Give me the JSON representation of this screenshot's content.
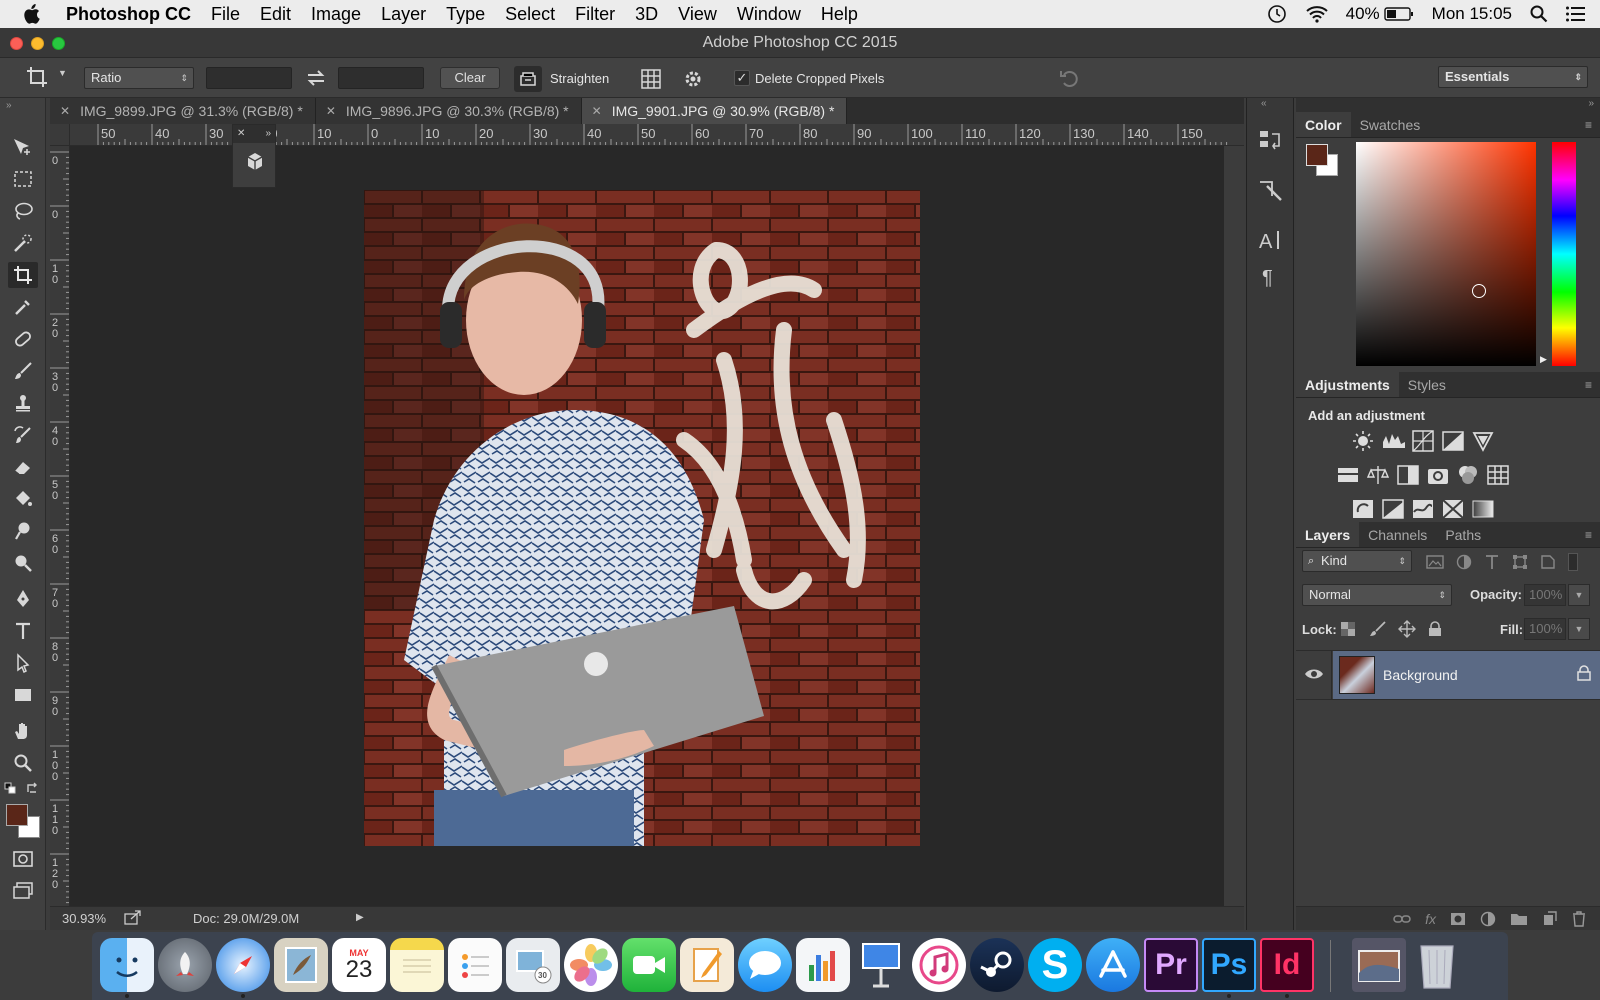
{
  "menubar": {
    "app": "Photoshop CC",
    "items": [
      "File",
      "Edit",
      "Image",
      "Layer",
      "Type",
      "Select",
      "Filter",
      "3D",
      "View",
      "Window",
      "Help"
    ],
    "battery": "40%",
    "clock": "Mon 15:05"
  },
  "window": {
    "title": "Adobe Photoshop CC 2015"
  },
  "options": {
    "ratio": "Ratio",
    "clear": "Clear",
    "straighten": "Straighten",
    "delete_cropped": "Delete Cropped Pixels",
    "delete_cropped_checked": true,
    "workspace": "Essentials"
  },
  "tabs": [
    {
      "label": "IMG_9899.JPG @ 31.3% (RGB/8) *",
      "active": false
    },
    {
      "label": "IMG_9896.JPG @ 30.3% (RGB/8) *",
      "active": false
    },
    {
      "label": "IMG_9901.JPG @ 30.9% (RGB/8) *",
      "active": true
    }
  ],
  "ruler": {
    "h_ticks": [
      "50",
      "40",
      "30",
      "20",
      "10",
      "0",
      "10",
      "20",
      "30",
      "40",
      "50",
      "60",
      "70",
      "80",
      "90",
      "100",
      "110",
      "120",
      "130",
      "140",
      "150"
    ],
    "v_ticks": [
      "0",
      "0",
      "1\n0",
      "2\n0",
      "3\n0",
      "4\n0",
      "5\n0",
      "6\n0",
      "7\n0",
      "8\n0",
      "9\n0",
      "1\n0\n0",
      "1\n1\n0",
      "1\n2\n0"
    ]
  },
  "status": {
    "zoom": "30.93%",
    "doc": "Doc: 29.0M/29.0M"
  },
  "colors": {
    "foreground": "#5a2618",
    "background": "#ffffff",
    "picker_hue": "#ff3300"
  },
  "color_panel": {
    "tabs": [
      "Color",
      "Swatches"
    ]
  },
  "adjustments": {
    "tabs": [
      "Adjustments",
      "Styles"
    ],
    "heading": "Add an adjustment"
  },
  "layers_panel": {
    "tabs": [
      "Layers",
      "Channels",
      "Paths"
    ],
    "kind": "Kind",
    "blend_mode": "Normal",
    "opacity_label": "Opacity:",
    "opacity": "100%",
    "lock_label": "Lock:",
    "fill_label": "Fill:",
    "fill": "100%",
    "layers": [
      {
        "name": "Background",
        "visible": true,
        "locked": true
      }
    ]
  },
  "dock": [
    "Finder",
    "Launchpad",
    "Safari",
    "Preview",
    "Calendar",
    "Notes",
    "Reminders",
    "Photo Slideshow",
    "Photos",
    "FaceTime",
    "Pages",
    "Messages",
    "Numbers",
    "Keynote",
    "iTunes",
    "Steam",
    "Skype",
    "App Store",
    "Premiere Pro",
    "Photoshop",
    "InDesign",
    "Photos Folder",
    "Trash"
  ],
  "dock_labels": {
    "calendar_month": "MAY",
    "calendar_day": "23",
    "premiere": "Pr",
    "photoshop": "Ps",
    "indesign": "Id"
  }
}
